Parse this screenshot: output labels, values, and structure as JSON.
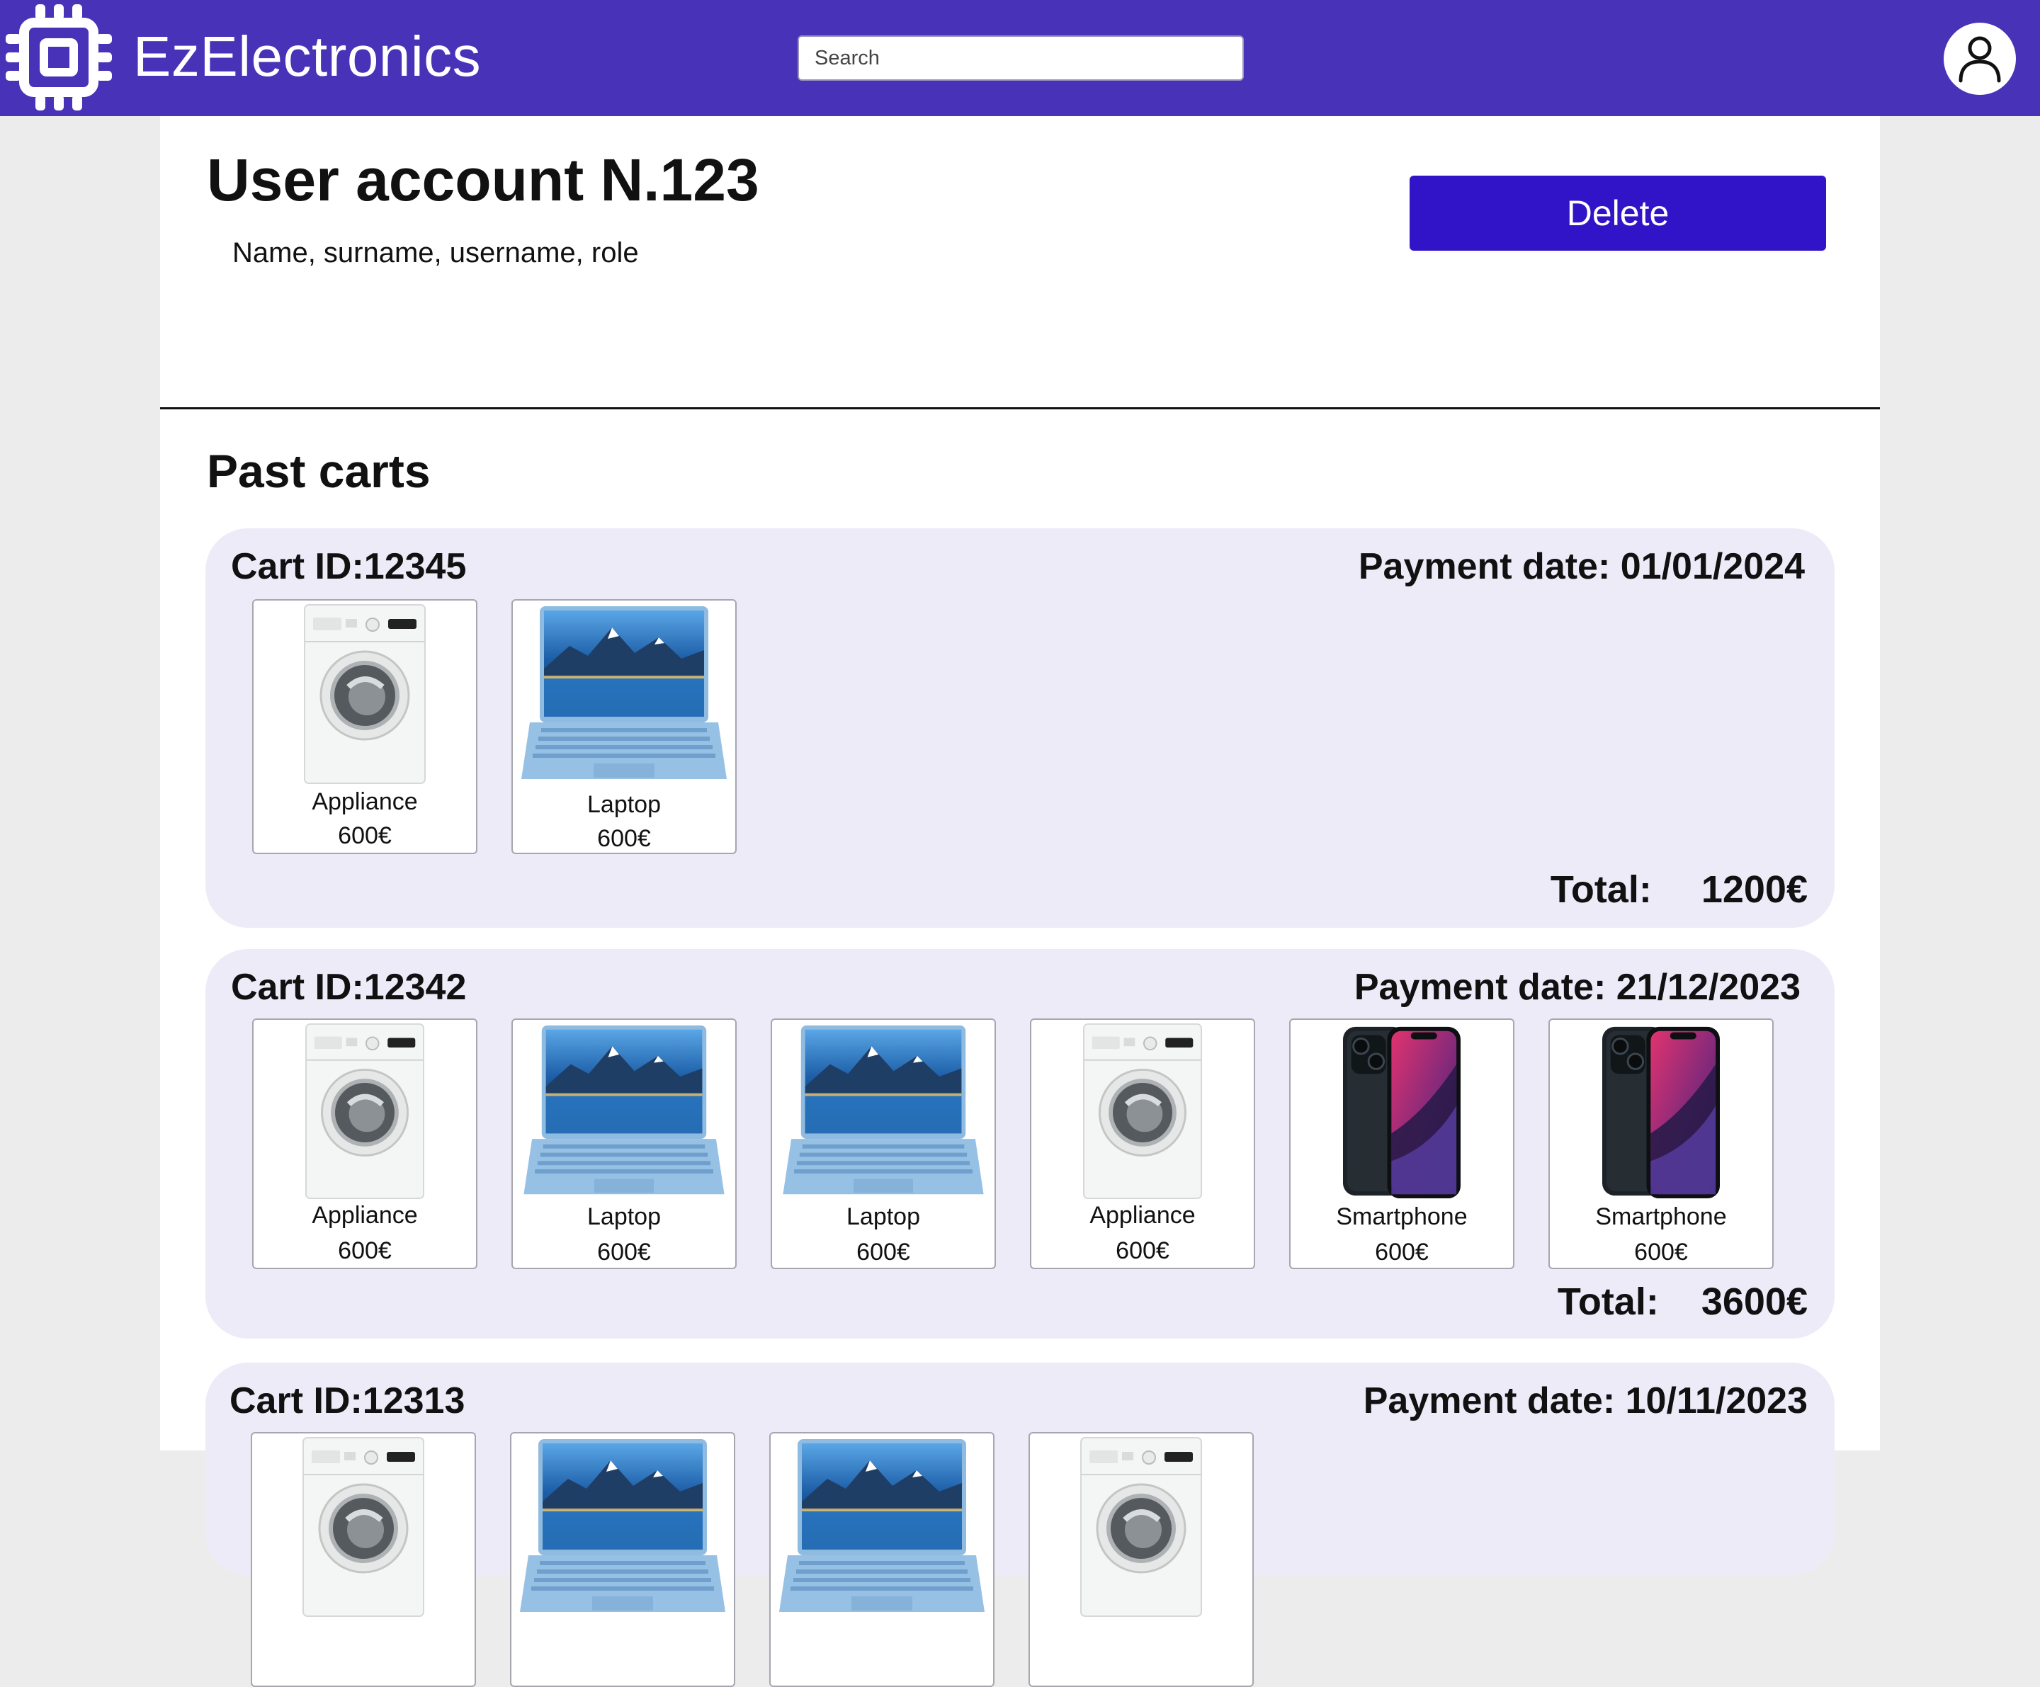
{
  "app": {
    "name": "EzElectronics"
  },
  "search": {
    "placeholder": "Search"
  },
  "account": {
    "title": "User account N.123",
    "details": "Name, surname, username, role",
    "delete_label": "Delete"
  },
  "past_carts": {
    "title": "Past carts",
    "total_label": "Total:",
    "carts": [
      {
        "id_label": "Cart ID:12345",
        "date_label": "Payment date: 01/01/2024",
        "total": "1200€",
        "items": [
          {
            "name": "Appliance",
            "price": "600€",
            "image": "washing-machine"
          },
          {
            "name": "Laptop",
            "price": "600€",
            "image": "laptop"
          }
        ]
      },
      {
        "id_label": "Cart ID:12342",
        "date_label": "Payment date: 21/12/2023",
        "total": "3600€",
        "items": [
          {
            "name": "Appliance",
            "price": "600€",
            "image": "washing-machine"
          },
          {
            "name": "Laptop",
            "price": "600€",
            "image": "laptop"
          },
          {
            "name": "Laptop",
            "price": "600€",
            "image": "laptop"
          },
          {
            "name": "Appliance",
            "price": "600€",
            "image": "washing-machine"
          },
          {
            "name": "Smartphone",
            "price": "600€",
            "image": "smartphone"
          },
          {
            "name": "Smartphone",
            "price": "600€",
            "image": "smartphone"
          }
        ]
      },
      {
        "id_label": "Cart ID:12313",
        "date_label": "Payment date:  10/11/2023",
        "items": [
          {
            "image": "washing-machine"
          },
          {
            "image": "laptop"
          },
          {
            "image": "laptop"
          },
          {
            "image": "washing-machine"
          }
        ]
      }
    ]
  },
  "colors": {
    "header": "#4832b8",
    "accent_button": "#3214c8",
    "cart_background": "#eeebf9",
    "page_background": "#ececec"
  },
  "icons": {
    "logo": "chip-icon",
    "profile": "user-icon"
  }
}
